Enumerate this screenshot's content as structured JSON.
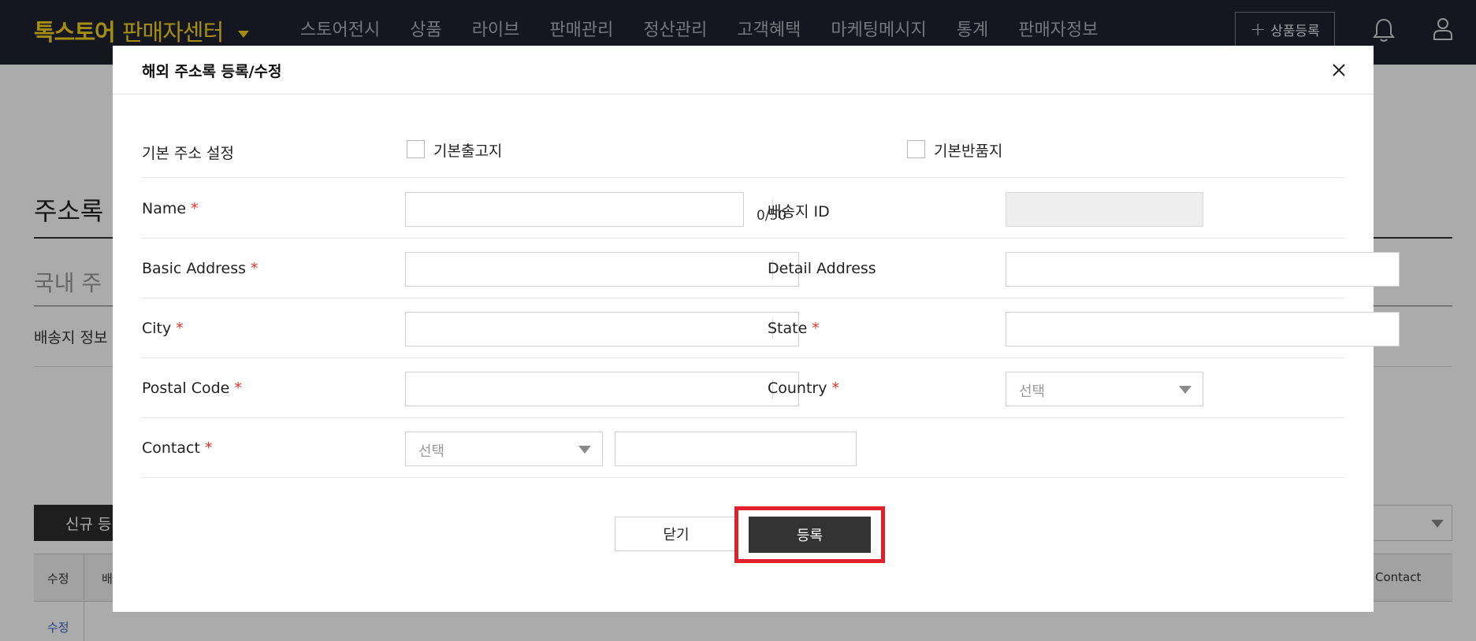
{
  "header": {
    "logo_main": "톡스토어",
    "logo_sub": "판매자센터",
    "nav": [
      "스토어전시",
      "상품",
      "라이브",
      "판매관리",
      "정산관리",
      "고객혜택",
      "마케팅메시지",
      "통계",
      "판매자정보"
    ],
    "register_button": "상품등록"
  },
  "page": {
    "title": "주소록",
    "subtitle": "국내 주",
    "info_text": "배송지 정보",
    "new_button": "신규 등",
    "table": {
      "col_edit": "수정",
      "col_name": "배",
      "col_contact": "Contact",
      "row_edit_link": "수정"
    }
  },
  "modal": {
    "title": "해외 주소록 등록/수정",
    "default_address": {
      "label": "기본 주소 설정",
      "checkbox_shipping": {
        "label": "기본출고지",
        "checked": false
      },
      "checkbox_return": {
        "label": "기본반품지",
        "checked": false
      }
    },
    "fields": {
      "name": {
        "label": "Name",
        "value": "",
        "counter": "0/50"
      },
      "shipping_id": {
        "label": "배송지 ID",
        "value": ""
      },
      "basic_address": {
        "label": "Basic Address",
        "value": ""
      },
      "detail_address": {
        "label": "Detail Address",
        "value": ""
      },
      "city": {
        "label": "City",
        "value": ""
      },
      "state": {
        "label": "State",
        "value": ""
      },
      "postal_code": {
        "label": "Postal Code",
        "value": ""
      },
      "country": {
        "label": "Country",
        "selected": "선택"
      },
      "contact": {
        "label": "Contact",
        "selected": "선택",
        "value": ""
      }
    },
    "required_mark": "*",
    "buttons": {
      "close": "닫기",
      "submit": "등록"
    }
  },
  "colors": {
    "topbar": "#1e2330",
    "logo": "#f6d21e",
    "required": "#e0312b",
    "submit_bg": "#333333",
    "highlight": "#e0202a"
  }
}
